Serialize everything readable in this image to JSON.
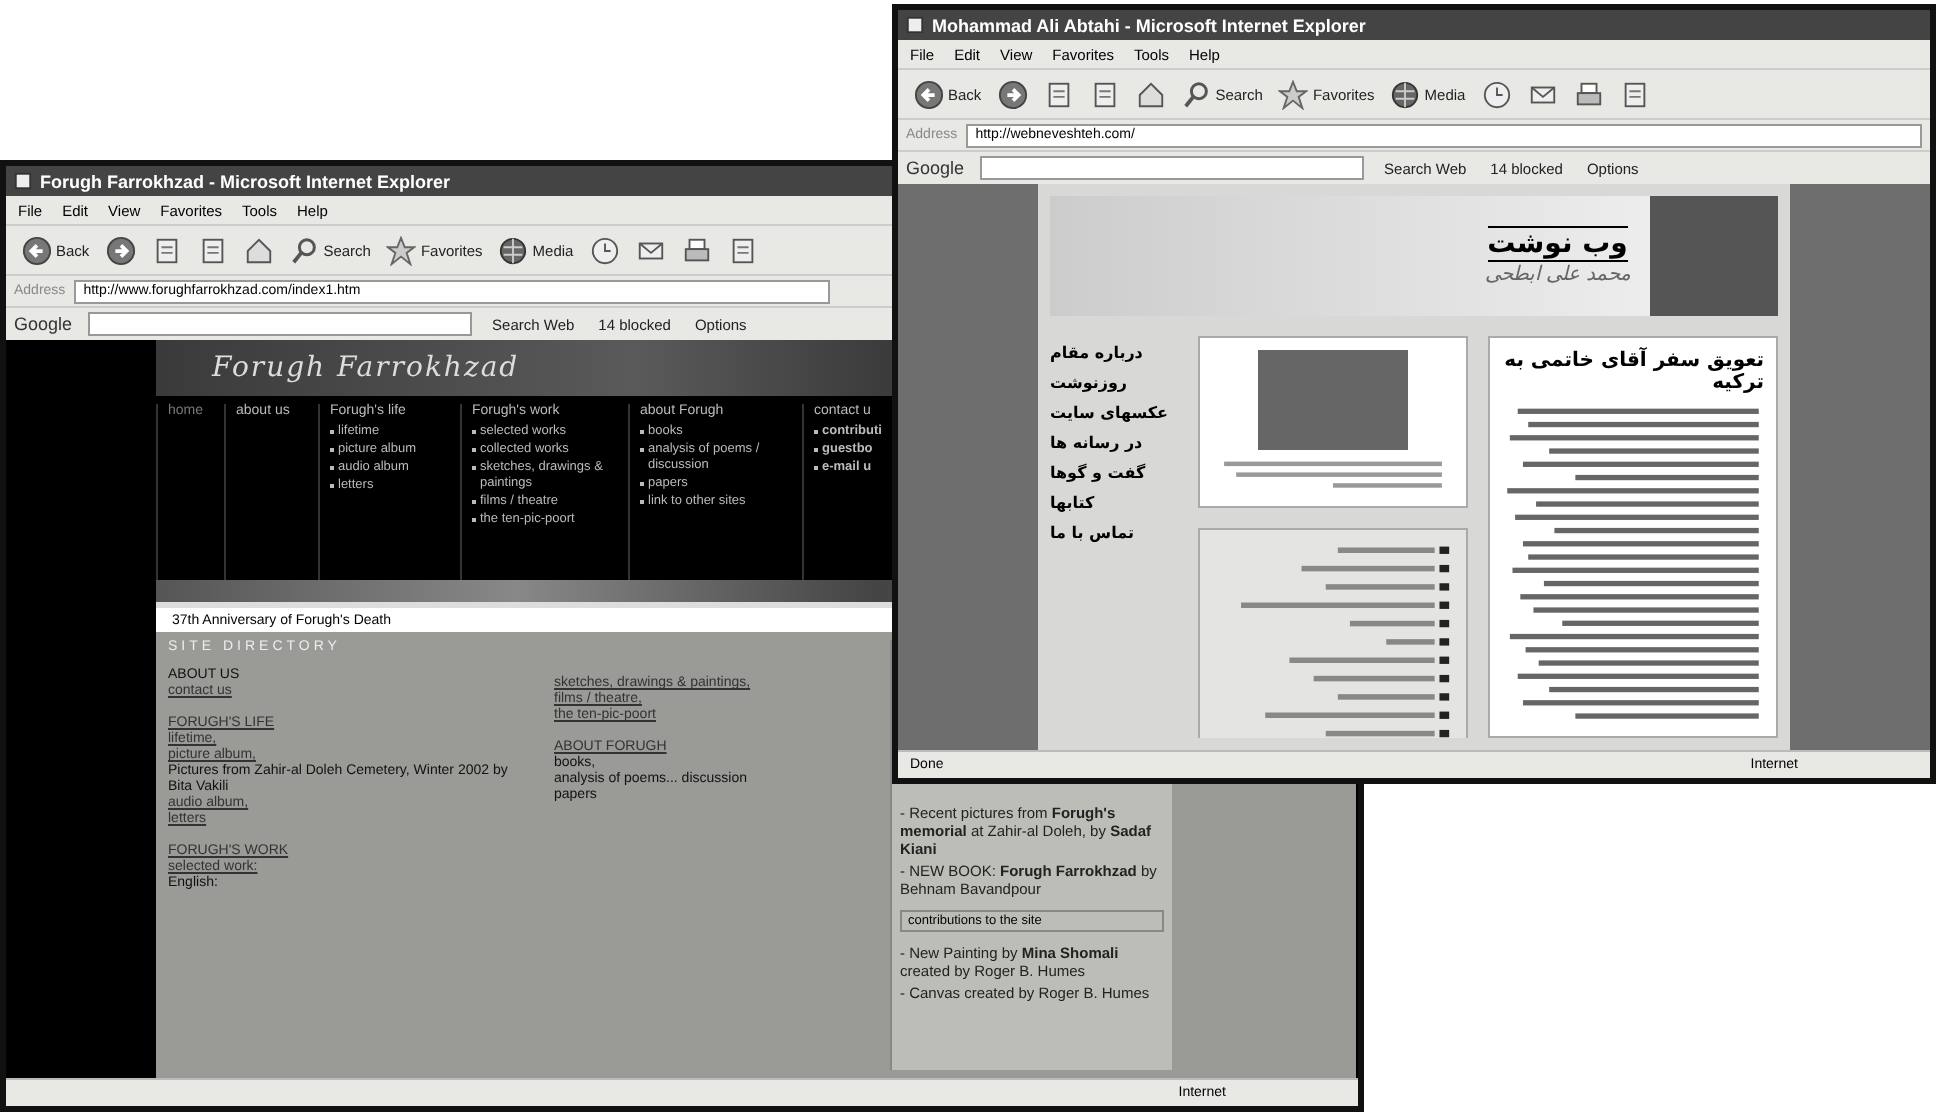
{
  "windows": [
    {
      "title": "Forugh Farrokhzad - Microsoft Internet Explorer",
      "menu": [
        "File",
        "Edit",
        "View",
        "Favorites",
        "Tools",
        "Help"
      ],
      "toolbar": [
        {
          "kind": "back",
          "label": "Back"
        },
        {
          "kind": "forward"
        },
        {
          "kind": "stop"
        },
        {
          "kind": "refresh"
        },
        {
          "kind": "home"
        },
        {
          "kind": "search",
          "label": "Search"
        },
        {
          "kind": "favorites",
          "label": "Favorites"
        },
        {
          "kind": "media",
          "label": "Media"
        },
        {
          "kind": "history"
        },
        {
          "kind": "mail"
        },
        {
          "kind": "print"
        },
        {
          "kind": "edit"
        }
      ],
      "address_label": "Address",
      "address": "http://www.forughfarrokhzad.com/index1.htm",
      "google": {
        "label": "Google",
        "search": "Search Web",
        "blocked": "14 blocked",
        "options": "Options"
      },
      "status_right": "Internet"
    },
    {
      "title": "Mohammad Ali Abtahi - Microsoft Internet Explorer",
      "menu": [
        "File",
        "Edit",
        "View",
        "Favorites",
        "Tools",
        "Help"
      ],
      "toolbar": [
        {
          "kind": "back",
          "label": "Back"
        },
        {
          "kind": "forward"
        },
        {
          "kind": "stop"
        },
        {
          "kind": "refresh"
        },
        {
          "kind": "home"
        },
        {
          "kind": "search",
          "label": "Search"
        },
        {
          "kind": "favorites",
          "label": "Favorites"
        },
        {
          "kind": "media",
          "label": "Media"
        },
        {
          "kind": "history"
        },
        {
          "kind": "mail"
        },
        {
          "kind": "print"
        },
        {
          "kind": "edit"
        }
      ],
      "address_label": "Address",
      "address": "http://webneveshteh.com/",
      "google": {
        "label": "Google",
        "search": "Search Web",
        "blocked": "14 blocked",
        "options": "Options"
      },
      "status_left": "Done",
      "status_right": "Internet"
    }
  ],
  "forugh_page": {
    "site_title": "Forugh Farrokhzad",
    "nav": [
      {
        "heading": "home",
        "selected": true
      },
      {
        "heading": "about us",
        "selected": false
      },
      {
        "heading": "Forugh's life",
        "selected": false,
        "items": [
          "lifetime",
          "picture album",
          "audio album",
          "letters"
        ]
      },
      {
        "heading": "Forugh's work",
        "selected": false,
        "items": [
          "selected works",
          "collected works",
          "sketches, drawings & paintings",
          "films / theatre",
          "the ten-pic-poort"
        ]
      },
      {
        "heading": "about Forugh",
        "selected": false,
        "items": [
          "books",
          "analysis of poems / discussion",
          "papers",
          "link to other sites"
        ]
      },
      {
        "heading": "contact u",
        "selected": false,
        "items": [
          "contributi",
          "guestbo",
          "e-mail u"
        ]
      }
    ],
    "anniversary": "37th Anniversary of Forugh's Death",
    "directory_heading": "SITE DIRECTORY",
    "directory_left": [
      {
        "lines": [
          {
            "text": "ABOUT US",
            "link": false
          },
          {
            "text": "contact us",
            "link": true
          }
        ]
      },
      {
        "lines": [
          {
            "text": "FORUGH'S LIFE",
            "link": true
          },
          {
            "text": "lifetime,",
            "link": true
          },
          {
            "text": "picture album,",
            "link": true
          },
          {
            "text": "Pictures from Zahir-al Doleh Cemetery, Winter 2002 by",
            "link": false
          },
          {
            "text": "Bita Vakili",
            "link": false
          },
          {
            "text": "audio album,",
            "link": true
          },
          {
            "text": "letters",
            "link": true
          }
        ]
      },
      {
        "lines": [
          {
            "text": "FORUGH'S WORK",
            "link": true
          },
          {
            "text": "selected work:",
            "link": true
          },
          {
            "text": "English:",
            "link": false
          }
        ]
      }
    ],
    "directory_right": [
      {
        "lines": [
          {
            "text": "sketches, drawings & paintings,",
            "link": true
          },
          {
            "text": "films / theatre,",
            "link": true
          },
          {
            "text": "the ten-pic-poort",
            "link": true
          }
        ]
      },
      {
        "lines": [
          {
            "text": "ABOUT FORUGH",
            "link": true
          },
          {
            "text": "books,",
            "link": false
          },
          {
            "text": "analysis of poems... discussion",
            "link": false
          },
          {
            "text": "papers",
            "link": false
          }
        ]
      }
    ],
    "news": [
      "- Recent pictures from **Forugh's memorial** at Zahir-al Doleh, by **Sadaf Kiani**",
      "- NEW BOOK: **Forugh Farrokhzad** by Behnam Bavandpour"
    ],
    "contributions_heading": "contributions to the site",
    "contributions": [
      "- New Painting by **Mina Shomali** created by Roger B. Humes",
      "- Canvas created by Roger B. Humes"
    ]
  },
  "abtahi_page": {
    "logo": "وب نوشت",
    "signature": "محمد علی ابطحی",
    "sidebar_links": [
      "درباره مقام",
      "روزنوشت",
      "عکسهای سایت",
      "در رسانه ها",
      "گفت و گوها",
      "کتابها",
      "تماس با ما"
    ],
    "post_title": "تعویق سفر آقای خاتمی به ترکیه"
  }
}
